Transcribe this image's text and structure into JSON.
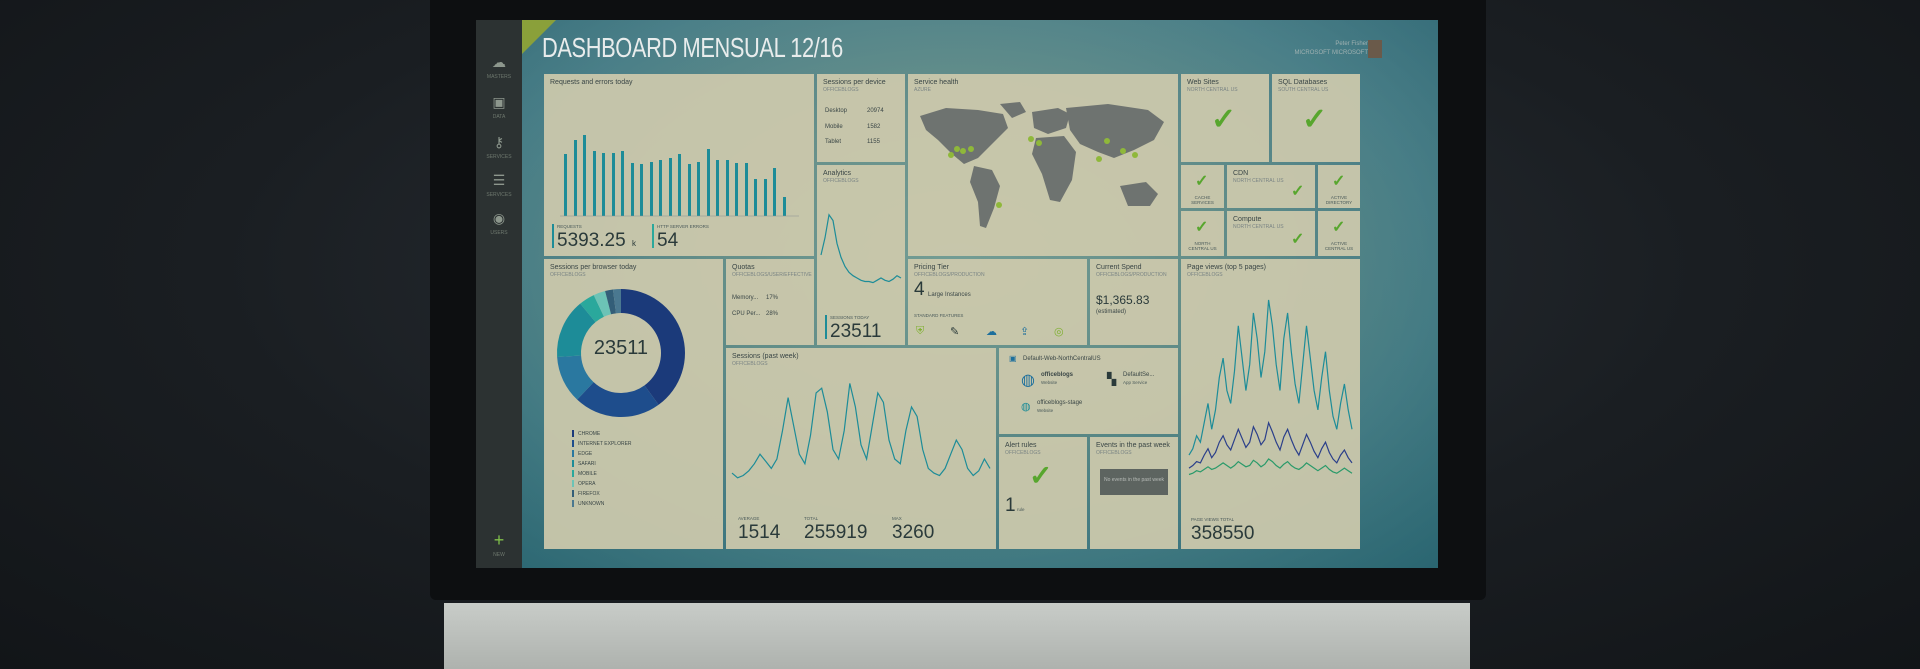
{
  "dashboard": {
    "title": "DASHBOARD MENSUAL 12/16",
    "user_name": "Peter Fisher",
    "user_org": "MICROSOFT MICROSOFT"
  },
  "sidebar": {
    "items": [
      {
        "icon": "cloud-icon",
        "label": "MASTERS"
      },
      {
        "icon": "monitor-icon",
        "label": "DATA"
      },
      {
        "icon": "key-icon",
        "label": "SERVICES"
      },
      {
        "icon": "list-icon",
        "label": "SERVICES"
      },
      {
        "icon": "globe-icon",
        "label": "USERS"
      }
    ],
    "add_label": "NEW"
  },
  "requests": {
    "title": "Requests and errors today",
    "requests_label": "REQUESTS",
    "requests_value": "5393.25",
    "requests_unit": "k",
    "errors_label": "HTTP SERVER ERRORS",
    "errors_value": "54"
  },
  "sessions_device": {
    "title": "Sessions per device",
    "subtitle": "OFFICEBLOGS",
    "rows": [
      {
        "device": "Desktop",
        "count": "20974"
      },
      {
        "device": "Mobile",
        "count": "1582"
      },
      {
        "device": "Tablet",
        "count": "1155"
      }
    ]
  },
  "analytics": {
    "title": "Analytics",
    "subtitle": "OFFICEBLOGS",
    "sessions_label": "SESSIONS TODAY",
    "sessions_value": "23511"
  },
  "service_health": {
    "title": "Service health",
    "subtitle": "AZURE"
  },
  "web_sites": {
    "title": "Web Sites",
    "subtitle": "NORTH CENTRAL US"
  },
  "sql": {
    "title": "SQL Databases",
    "subtitle": "SOUTH CENTRAL US"
  },
  "cache": {
    "label": "CACHE SERVICES"
  },
  "cdn": {
    "title": "CDN",
    "subtitle": "NORTH CENTRAL US"
  },
  "active_dir": {
    "label": "ACTIVE DIRECTORY"
  },
  "north_central": {
    "label": "NORTH CENTRAL US"
  },
  "compute": {
    "title": "Compute",
    "subtitle": "NORTH CENTRAL US"
  },
  "active_central": {
    "label": "ACTIVE CENTRAL US"
  },
  "sessions_browser": {
    "title": "Sessions per browser today",
    "subtitle": "OFFICEBLOGS",
    "center_value": "23511",
    "legend": [
      "CHROME",
      "INTERNET EXPLORER",
      "EDGE",
      "SAFARI",
      "MOBILE",
      "OPERA",
      "FIREFOX",
      "UNKNOWN"
    ]
  },
  "quotas": {
    "title": "Quotas",
    "subtitle": "OFFICEBLOGS/USER/EFFECTIVE",
    "rows": [
      {
        "name": "Memory...",
        "value": "17%"
      },
      {
        "name": "CPU Per...",
        "value": "28%"
      }
    ]
  },
  "pricing": {
    "title": "Pricing Tier",
    "subtitle": "OFFICEBLOGS/PRODUCTION",
    "count": "4",
    "count_label": "Large Instances",
    "features_label": "STANDARD FEATURES"
  },
  "spend": {
    "title": "Current Spend",
    "subtitle": "OFFICEBLOGS/PRODUCTION",
    "value": "$1,365.83",
    "note": "(estimated)"
  },
  "page_views": {
    "title": "Page views (top 5 pages)",
    "subtitle": "OFFICEBLOGS",
    "total_label": "PAGE VIEWS TOTAL",
    "total": "358550"
  },
  "sessions_week": {
    "title": "Sessions (past week)",
    "subtitle": "OFFICEBLOGS",
    "stats": [
      {
        "label": "AVERAGE",
        "value": "1514"
      },
      {
        "label": "TOTAL",
        "value": "255919"
      },
      {
        "label": "MAX",
        "value": "3260"
      }
    ]
  },
  "resources": {
    "group": "Default-Web-NorthCentralUS",
    "items": [
      {
        "name": "officeblogs",
        "type": "Website"
      },
      {
        "name": "DefaultSe...",
        "type": "App Service"
      },
      {
        "name": "officeblogs-stage",
        "type": "Website"
      }
    ]
  },
  "alerts": {
    "title": "Alert rules",
    "subtitle": "OFFICEBLOGS",
    "count": "1",
    "count_label": "rule"
  },
  "events": {
    "title": "Events in the past week",
    "subtitle": "OFFICEBLOGS",
    "message": "No events in the past week"
  },
  "chart_data": [
    {
      "type": "bar",
      "title": "Requests and errors today",
      "values": [
        55,
        68,
        72,
        58,
        56,
        56,
        58,
        47,
        46,
        48,
        50,
        52,
        55,
        46,
        48,
        60,
        50,
        50,
        47,
        47,
        33,
        33,
        43,
        17
      ]
    },
    {
      "type": "pie",
      "title": "Sessions per browser today",
      "categories": [
        "CHROME",
        "INTERNET EXPLORER",
        "EDGE",
        "SAFARI",
        "MOBILE",
        "OPERA",
        "FIREFOX",
        "UNKNOWN"
      ],
      "values": [
        40,
        22,
        12,
        15,
        4,
        3,
        2,
        2
      ],
      "colors": [
        "#1b3a7a",
        "#1e4d8c",
        "#2a78a0",
        "#1d8c98",
        "#2aa89c",
        "#6cc3b6",
        "#335e78",
        "#4a7890"
      ]
    },
    {
      "type": "line",
      "title": "Sessions (past week)",
      "values": [
        1200,
        1100,
        1150,
        1250,
        1400,
        1600,
        1450,
        1300,
        1500,
        2100,
        2800,
        2200,
        1600,
        1400,
        2000,
        2900,
        3000,
        2500,
        1700,
        1500,
        2100,
        3100,
        2600,
        1800,
        1500,
        2200,
        2900,
        2700,
        1900,
        1500,
        1400,
        2100,
        2600,
        2400,
        1700,
        1300,
        1200,
        1150,
        1300,
        1600,
        1900,
        1700,
        1300,
        1150,
        1250,
        1500,
        1300
      ]
    },
    {
      "type": "line",
      "title": "Page views (top 5 pages)",
      "series": [
        {
          "values": [
            20,
            25,
            35,
            30,
            45,
            60,
            40,
            55,
            80,
            95,
            70,
            60,
            85,
            120,
            95,
            70,
            90,
            130,
            110,
            80,
            100,
            140,
            120,
            90,
            70,
            110,
            130,
            100,
            75,
            60,
            90,
            120,
            95,
            70,
            55,
            80,
            100,
            70,
            50,
            40,
            60,
            75,
            55,
            40
          ],
          "color": "#1d8c98"
        },
        {
          "values": [
            10,
            12,
            15,
            14,
            20,
            25,
            18,
            22,
            30,
            35,
            28,
            24,
            32,
            40,
            33,
            26,
            30,
            42,
            36,
            28,
            32,
            45,
            38,
            30,
            24,
            34,
            40,
            32,
            25,
            20,
            28,
            36,
            30,
            23,
            18,
            25,
            30,
            22,
            17,
            14,
            20,
            24,
            18,
            14
          ],
          "color": "#2b3f8a"
        },
        {
          "values": [
            5,
            6,
            8,
            7,
            9,
            11,
            9,
            10,
            12,
            14,
            12,
            10,
            12,
            15,
            13,
            11,
            12,
            16,
            14,
            11,
            13,
            17,
            15,
            12,
            10,
            13,
            15,
            12,
            10,
            9,
            11,
            14,
            12,
            10,
            8,
            10,
            12,
            9,
            7,
            6,
            8,
            10,
            8,
            6
          ],
          "color": "#2a9a6a"
        }
      ]
    },
    {
      "type": "line",
      "title": "Analytics",
      "values": [
        40,
        55,
        75,
        70,
        50,
        38,
        30,
        25,
        22,
        20,
        18,
        17,
        17,
        16,
        18,
        20,
        18,
        17,
        19,
        22,
        20
      ]
    }
  ]
}
